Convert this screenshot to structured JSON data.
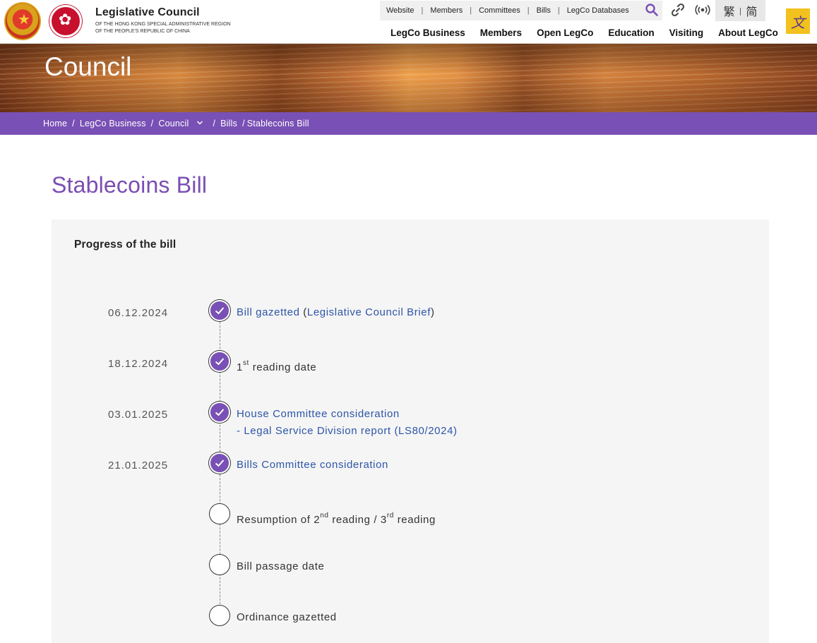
{
  "brand": {
    "title": "Legislative Council",
    "subtitle": "OF THE HONG KONG SPECIAL ADMINISTRATIVE REGION OF THE PEOPLE'S REPUBLIC OF CHINA"
  },
  "utility_nav": [
    "Website",
    "Members",
    "Committees",
    "Bills",
    "LegCo Databases"
  ],
  "language": {
    "traditional": "繁",
    "simplified": "简"
  },
  "main_nav": [
    "LegCo Business",
    "Members",
    "Open LegCo",
    "Education",
    "Visiting",
    "About LegCo"
  ],
  "banner": {
    "title": "Council"
  },
  "breadcrumb": {
    "home": "Home",
    "business": "LegCo Business",
    "council": "Council",
    "bills": "Bills",
    "current": "Stablecoins Bill"
  },
  "page": {
    "title": "Stablecoins Bill"
  },
  "progress": {
    "title": "Progress of the bill",
    "steps": [
      {
        "date": "06.12.2024",
        "link1": "Bill gazetted",
        "paren_open": " (",
        "link2": "Legislative Council Brief",
        "paren_close": ")"
      },
      {
        "date": "18.12.2024",
        "pre": "1",
        "sup": "st",
        "post": " reading date"
      },
      {
        "date": "03.01.2025",
        "line1": "House Committee consideration",
        "line2": "- Legal Service Division report (LS80/2024)"
      },
      {
        "date": "21.01.2025",
        "link1": "Bills Committee consideration"
      },
      {
        "date": "",
        "a": "Resumption of 2",
        "sup1": "nd",
        "b": " reading / 3",
        "sup2": "rd",
        "c": " reading"
      },
      {
        "date": "",
        "text": "Bill passage date"
      },
      {
        "date": "",
        "text": "Ordinance gazetted"
      }
    ]
  },
  "colors": {
    "brand_purple": "#7950b5",
    "title_purple": "#7a4db3",
    "link_blue": "#2d55a8"
  }
}
